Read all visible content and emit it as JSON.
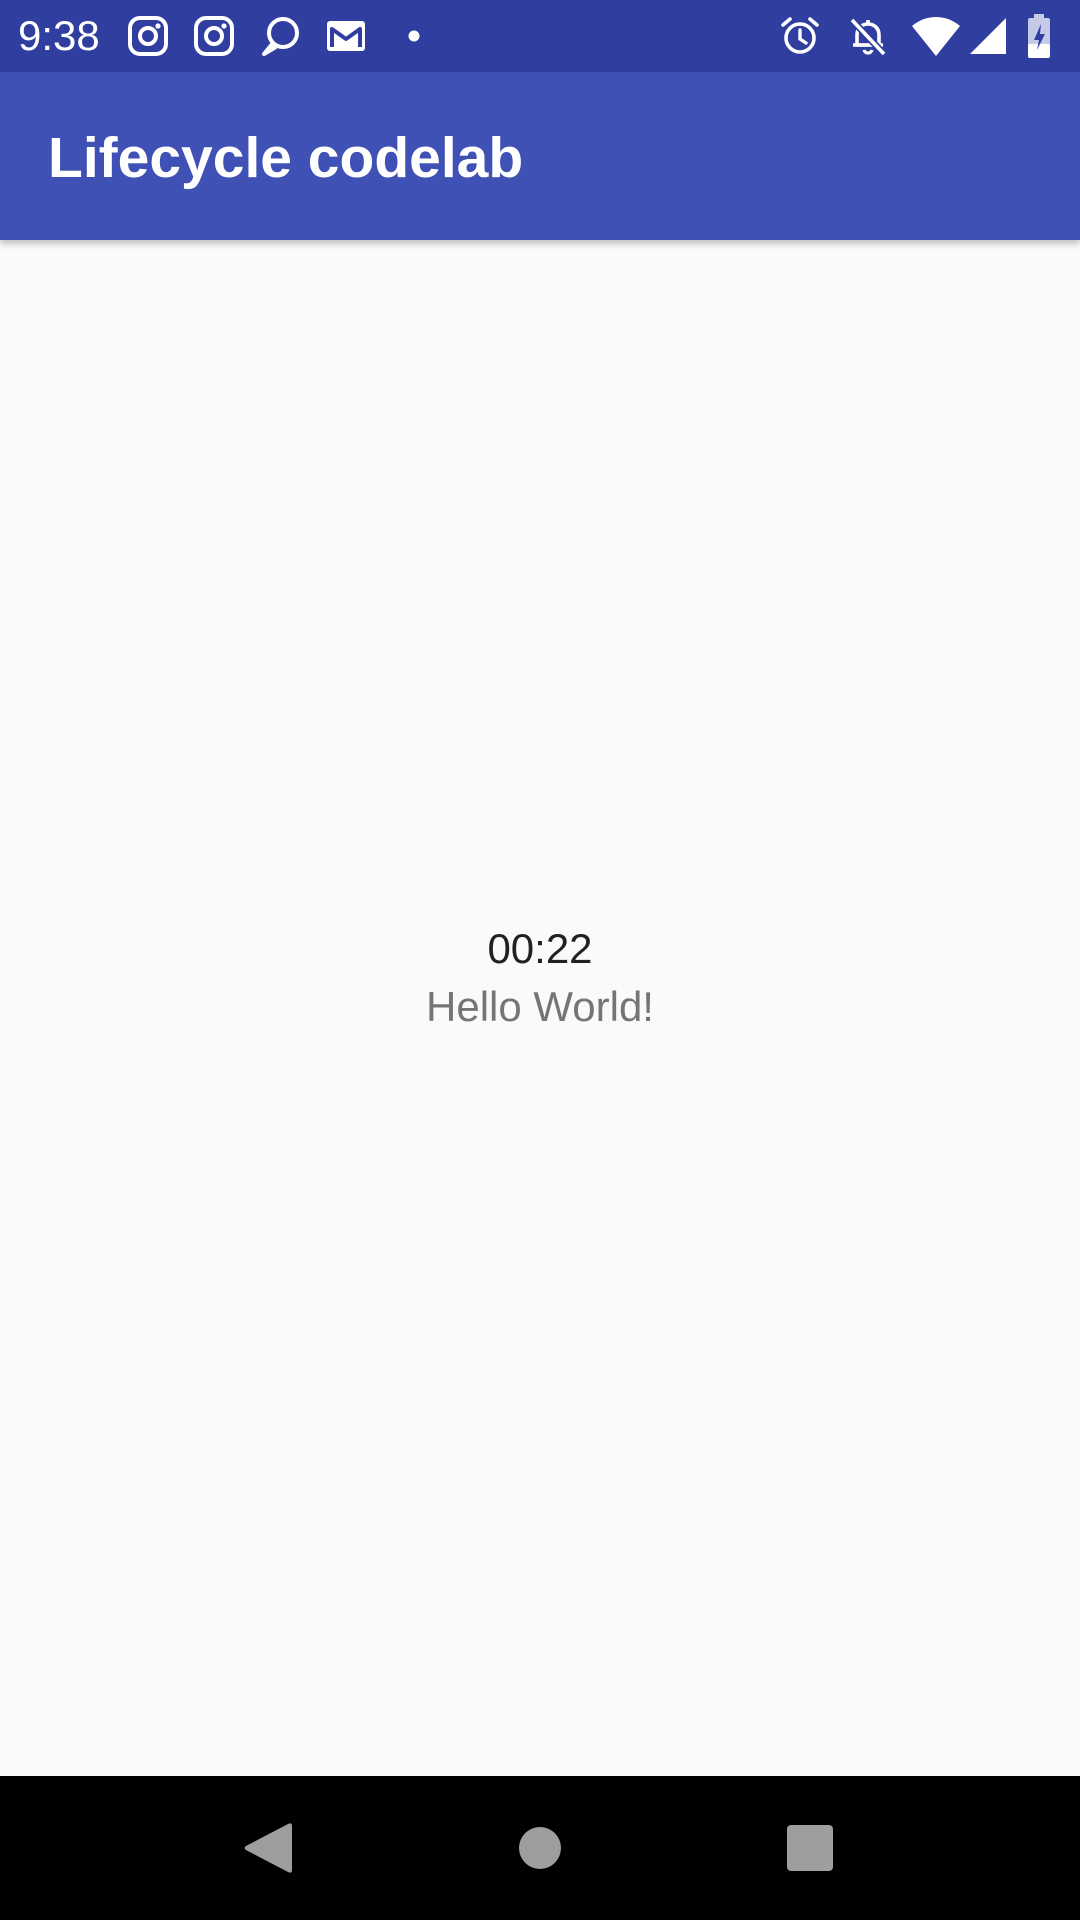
{
  "status_bar": {
    "time": "9:38",
    "background": "#303f9f",
    "notification_icons": [
      "instagram-icon",
      "instagram-icon",
      "chat-bubble-icon",
      "gmail-icon",
      "more-dot-icon"
    ],
    "system_icons": [
      "alarm-icon",
      "notifications-off-icon",
      "wifi-icon",
      "cell-signal-icon",
      "battery-charging-icon"
    ]
  },
  "app_bar": {
    "title": "Lifecycle codelab",
    "background": "#3f51b5"
  },
  "main": {
    "timer": "00:22",
    "greeting": "Hello World!"
  },
  "nav_bar": {
    "buttons": [
      "back-icon",
      "home-icon",
      "recents-icon"
    ],
    "background": "#000000"
  }
}
